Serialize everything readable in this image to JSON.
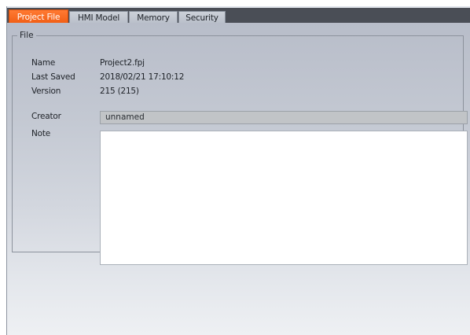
{
  "tabs": [
    {
      "label": "Project File",
      "active": true
    },
    {
      "label": "HMI Model",
      "active": false
    },
    {
      "label": "Memory",
      "active": false
    },
    {
      "label": "Security",
      "active": false
    }
  ],
  "file_group": {
    "legend": "File",
    "name_label": "Name",
    "name_value": "Project2.fpj",
    "last_saved_label": "Last Saved",
    "last_saved_value": "2018/02/21 17:10:12",
    "version_label": "Version",
    "version_value": "215 (215)",
    "creator_label": "Creator",
    "creator_value": "unnamed",
    "note_label": "Note",
    "note_value": ""
  },
  "colors": {
    "active_tab": "#f05c12",
    "tab_strip": "#4a4e56"
  }
}
